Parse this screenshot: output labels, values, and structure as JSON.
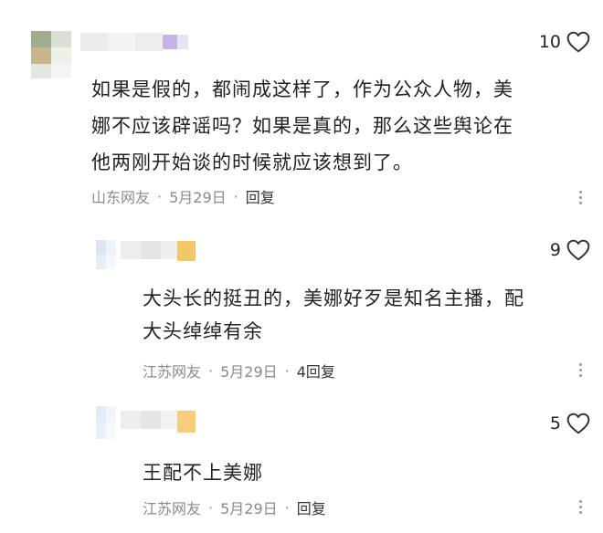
{
  "comments": [
    {
      "like_count": "10",
      "text_lines": [
        "如果是假的，都闹成这样了，作为公众人物，美",
        "娜不应该辟谣吗？如果是真的，那么这些舆论在",
        "他两刚开始谈的时候就应该想到了。"
      ],
      "location": "山东网友",
      "date": "5月29日",
      "separator": "·",
      "reply_label": "回复"
    },
    {
      "like_count": "9",
      "text_lines": [
        "大头长的挺丑的，美娜好歹是知名主播，配",
        "大头绰绰有余"
      ],
      "location": "江苏网友",
      "date": "5月29日",
      "separator": "·",
      "reply_label": "4回复"
    },
    {
      "like_count": "5",
      "text_lines": [
        "王配不上美娜"
      ],
      "location": "江苏网友",
      "date": "5月29日",
      "separator": "·",
      "reply_label": "回复"
    }
  ],
  "icons": {
    "like": "heart-outline-icon",
    "more": "vertical-ellipsis-icon"
  },
  "colors": {
    "text": "#222222",
    "meta": "#8a8a8a",
    "background": "#ffffff"
  }
}
